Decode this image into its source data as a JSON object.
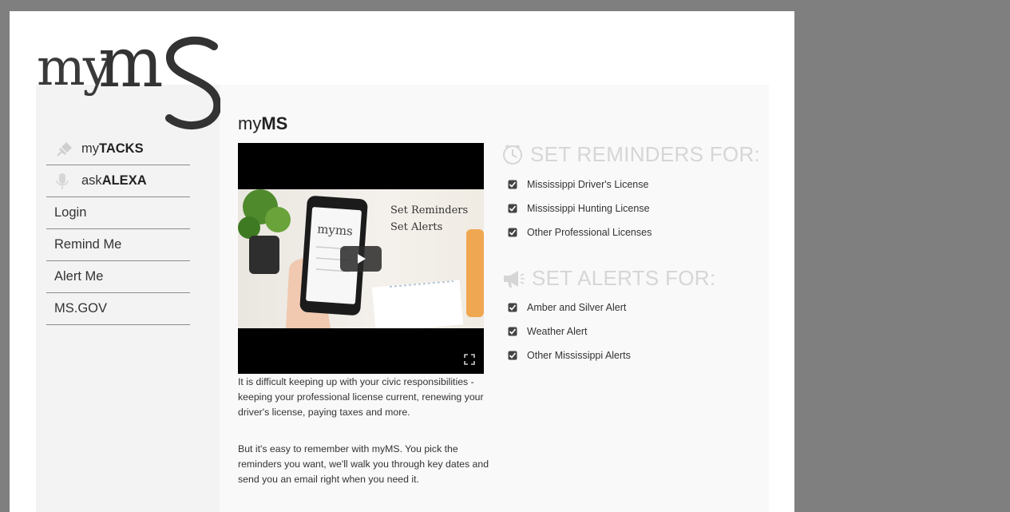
{
  "logo": {
    "text_my": "my",
    "text_ms": "MS"
  },
  "sidebar": {
    "items": [
      {
        "prefix": "my",
        "bold": "TACKS",
        "icon": "pin-icon"
      },
      {
        "prefix": "ask",
        "bold": "ALEXA",
        "icon": "microphone-icon"
      },
      {
        "label": "Login"
      },
      {
        "label": "Remind Me"
      },
      {
        "label": "Alert Me"
      },
      {
        "label": "MS.GOV"
      }
    ]
  },
  "main": {
    "title_prefix": "my",
    "title_bold": "MS",
    "video": {
      "overlay_line1": "Set Reminders",
      "overlay_line2": "Set Alerts",
      "phone_logo": "myms"
    },
    "paragraph1": "It is difficult keeping up with your civic responsibilities - keeping your professional license current, renewing your driver's license, paying taxes and more.",
    "paragraph2": "But it's easy to remember with myMS. You pick the reminders you want, we'll walk you through key dates and send you an email right when you need it."
  },
  "reminders": {
    "heading": "SET REMINDERS FOR:",
    "icon": "clock-icon",
    "items": [
      "Mississippi Driver's License",
      "Mississippi Hunting License",
      "Other Professional Licenses"
    ]
  },
  "alerts": {
    "heading": "SET ALERTS FOR:",
    "icon": "megaphone-icon",
    "items": [
      "Amber and Silver Alert",
      "Weather Alert",
      "Other Mississippi Alerts"
    ]
  },
  "colors": {
    "frame": "#7f7f7f",
    "sidebar_bg": "#f3f3f3",
    "content_bg": "#faf9f9",
    "heading_gray": "#d6d6d6",
    "logo": "#333333"
  }
}
